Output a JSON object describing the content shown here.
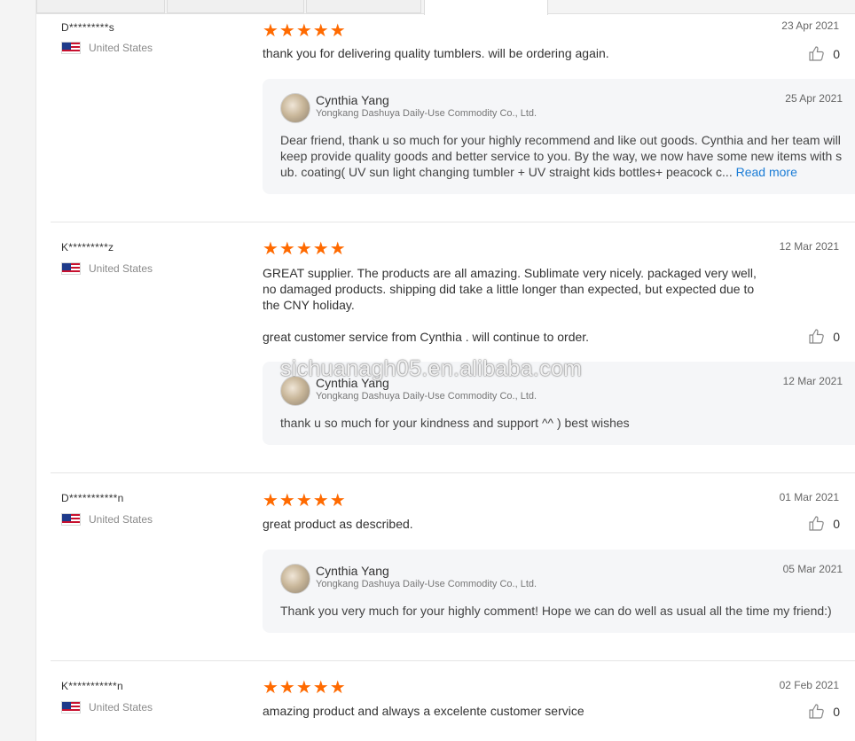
{
  "reviews": [
    {
      "username": "D*********s",
      "country": "United States",
      "rating": 5,
      "stars": "★★★★★",
      "date": "23 Apr 2021",
      "text": "thank you for delivering quality tumblers. will be ordering again.",
      "likes": "0",
      "reply": {
        "name": "Cynthia Yang",
        "company": "Yongkang Dashuya Daily-Use Commodity Co., Ltd.",
        "date": "25 Apr 2021",
        "text": "Dear friend, thank u so much for your highly recommend and like out goods. Cynthia and her team will keep provide quality goods and better service to you. By the way, we now have some new items with sub. coating( UV sun light changing tumbler + UV straight kids bottles+ peacock c...",
        "read_more": "Read more"
      }
    },
    {
      "username": "K*********z",
      "country": "United States",
      "rating": 5,
      "stars": "★★★★★",
      "date": "12 Mar 2021",
      "text": "GREAT supplier. The products are all amazing. Sublimate very nicely. packaged very well, no damaged products. shipping did take a little longer than expected, but expected due to the CNY holiday.",
      "text2": "great customer service from Cynthia . will continue to order.",
      "likes": "0",
      "reply": {
        "name": "Cynthia Yang",
        "company": "Yongkang Dashuya Daily-Use Commodity Co., Ltd.",
        "date": "12 Mar 2021",
        "text": "thank u so much for your kindness and support ^^ ) best wishes"
      }
    },
    {
      "username": "D***********n",
      "country": "United States",
      "rating": 5,
      "stars": "★★★★★",
      "date": "01 Mar 2021",
      "text": "great product as described.",
      "likes": "0",
      "reply": {
        "name": "Cynthia Yang",
        "company": "Yongkang Dashuya Daily-Use Commodity Co., Ltd.",
        "date": "05 Mar 2021",
        "text": "Thank you very much for your highly comment! Hope we can do well as usual all the time my friend:)"
      }
    },
    {
      "username": "K***********n",
      "country": "United States",
      "rating": 5,
      "stars": "★★★★★",
      "date": "02 Feb 2021",
      "text": "amazing product and always a excelente customer service",
      "likes": "0"
    }
  ],
  "watermark": "sichuanagh05.en.alibaba.com",
  "colors": {
    "star": "#ff6a00",
    "link": "#1a7cd6",
    "reply_bg": "#f5f6f8"
  },
  "icons": {
    "like": "thumbs-up-icon",
    "flag": "us-flag-icon",
    "star": "star-icon"
  }
}
